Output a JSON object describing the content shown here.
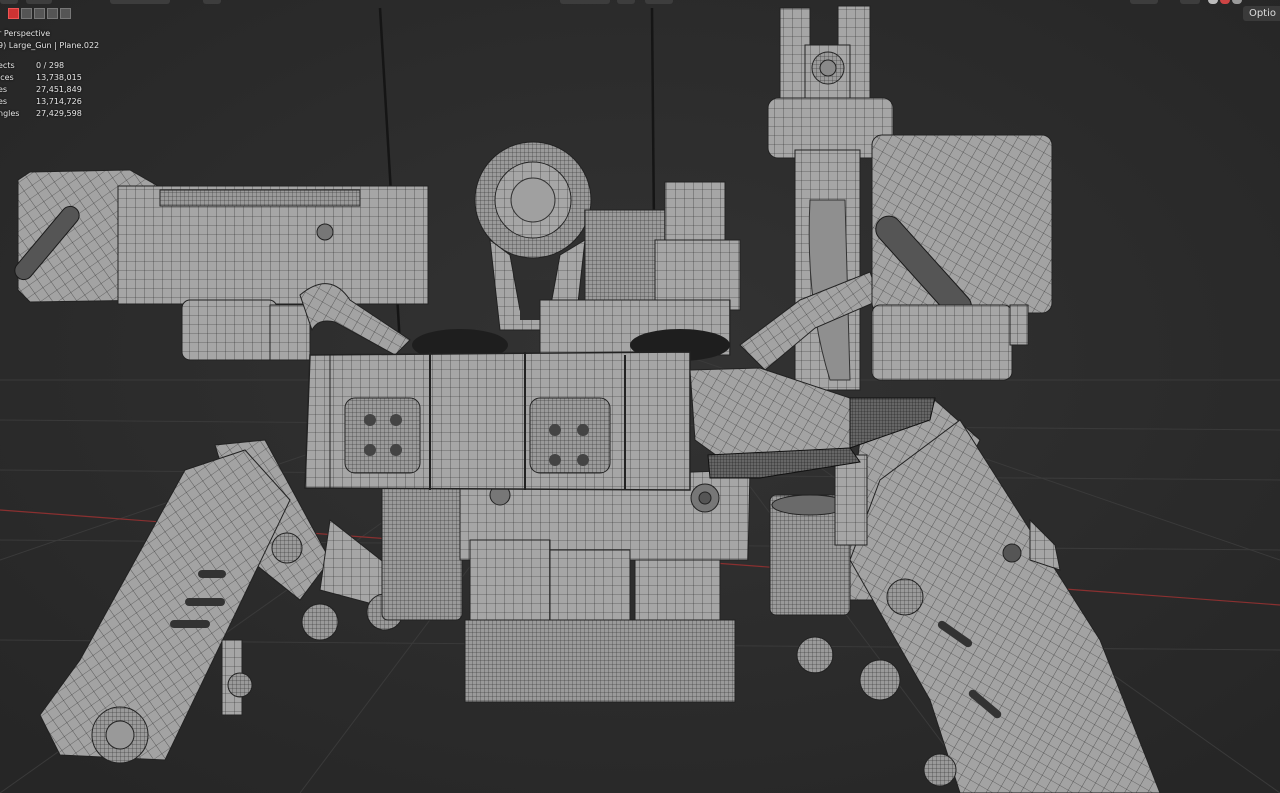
{
  "viewport": {
    "view_name": "r Perspective",
    "object_info": "9) Large_Gun | Plane.022",
    "stats": [
      {
        "label": "ects",
        "value": "0 / 298"
      },
      {
        "label": "ices",
        "value": "13,738,015"
      },
      {
        "label": "es",
        "value": "27,451,849"
      },
      {
        "label": "es",
        "value": "13,714,726"
      },
      {
        "label": "ngles",
        "value": "27,429,598"
      }
    ]
  },
  "header": {
    "options_label": "Optio"
  },
  "colors": {
    "background": "#2b2b2b",
    "mesh": "#a4a4a4",
    "wire": "#262626",
    "x_axis": "#8a3030"
  }
}
